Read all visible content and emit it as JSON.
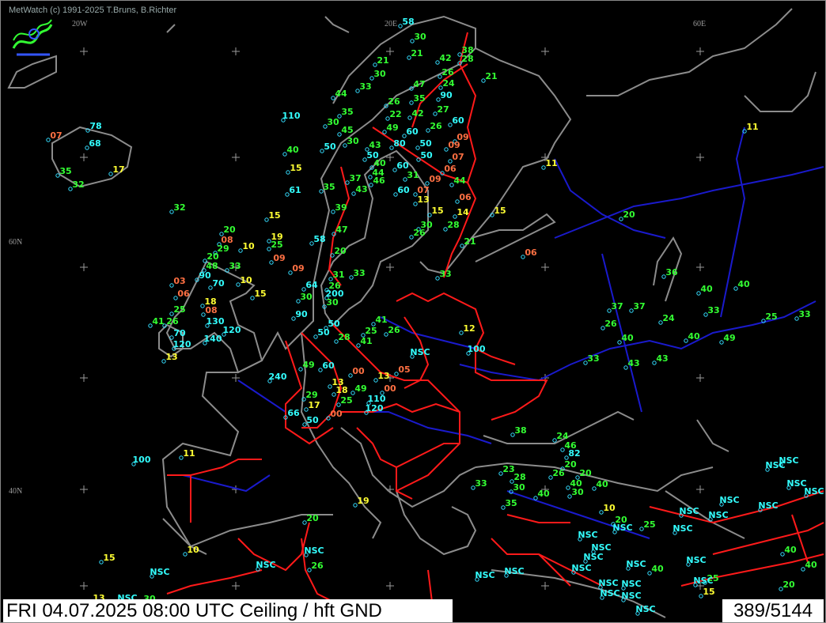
{
  "header": {
    "credit": "MetWatch  (c) 1991-2025 T.Bruns, B.Richter"
  },
  "footer": {
    "datetime_and_product": "FRI 04.07.2025 08:00 UTC     Ceiling / hft GND",
    "count": "389/5144"
  },
  "grid_labels": [
    {
      "text": "20W",
      "lon": -20,
      "lat": "top"
    },
    {
      "text": "20E",
      "lon": 20,
      "lat": "top"
    },
    {
      "text": "60E",
      "lon": 60,
      "lat": "top"
    },
    {
      "text": "60N",
      "lon": "left",
      "lat": 60
    },
    {
      "text": "40N",
      "lon": "left",
      "lat": 40
    }
  ],
  "colors": {
    "red": "#ff7043",
    "yellow": "#ffff33",
    "green": "#33ff33",
    "cyan": "#33ffff",
    "coast": "#8c8c8c",
    "river": "#1a1acc",
    "border": "#ff1a1a"
  },
  "stations": [
    {
      "t": "58",
      "c": "cyan"
    },
    {
      "t": "30",
      "c": "green"
    },
    {
      "t": "38",
      "c": "green"
    },
    {
      "t": "28",
      "c": "green"
    },
    {
      "t": "21",
      "c": "green"
    },
    {
      "t": "30",
      "c": "green"
    },
    {
      "t": "21",
      "c": "green"
    },
    {
      "t": "42",
      "c": "green"
    },
    {
      "t": "26",
      "c": "green"
    },
    {
      "t": "21",
      "c": "green"
    },
    {
      "t": "33",
      "c": "green"
    },
    {
      "t": "47",
      "c": "green"
    },
    {
      "t": "24",
      "c": "green"
    },
    {
      "t": "44",
      "c": "green"
    },
    {
      "t": "35",
      "c": "green"
    },
    {
      "t": "90",
      "c": "cyan"
    },
    {
      "t": "26",
      "c": "green"
    },
    {
      "t": "35",
      "c": "green"
    },
    {
      "t": "22",
      "c": "green"
    },
    {
      "t": "42",
      "c": "green"
    },
    {
      "t": "27",
      "c": "green"
    },
    {
      "t": "110",
      "c": "cyan"
    },
    {
      "t": "30",
      "c": "green"
    },
    {
      "t": "60",
      "c": "cyan"
    },
    {
      "t": "78",
      "c": "cyan"
    },
    {
      "t": "45",
      "c": "green"
    },
    {
      "t": "49",
      "c": "green"
    },
    {
      "t": "60",
      "c": "cyan"
    },
    {
      "t": "26",
      "c": "green"
    },
    {
      "t": "07",
      "c": "red"
    },
    {
      "t": "68",
      "c": "cyan"
    },
    {
      "t": "30",
      "c": "green"
    },
    {
      "t": "43",
      "c": "green"
    },
    {
      "t": "80",
      "c": "cyan"
    },
    {
      "t": "50",
      "c": "cyan"
    },
    {
      "t": "09",
      "c": "red"
    },
    {
      "t": "09",
      "c": "red"
    },
    {
      "t": "11",
      "c": "yellow"
    },
    {
      "t": "40",
      "c": "green"
    },
    {
      "t": "50",
      "c": "cyan"
    },
    {
      "t": "50",
      "c": "cyan"
    },
    {
      "t": "50",
      "c": "cyan"
    },
    {
      "t": "07",
      "c": "red"
    },
    {
      "t": "40",
      "c": "green"
    },
    {
      "t": "60",
      "c": "cyan"
    },
    {
      "t": "06",
      "c": "red"
    },
    {
      "t": "11",
      "c": "yellow"
    },
    {
      "t": "15",
      "c": "yellow"
    },
    {
      "t": "17",
      "c": "yellow"
    },
    {
      "t": "35",
      "c": "green"
    },
    {
      "t": "44",
      "c": "green"
    },
    {
      "t": "31",
      "c": "green"
    },
    {
      "t": "09",
      "c": "red"
    },
    {
      "t": "44",
      "c": "green"
    },
    {
      "t": "32",
      "c": "green"
    },
    {
      "t": "37",
      "c": "green"
    },
    {
      "t": "46",
      "c": "green"
    },
    {
      "t": "60",
      "c": "cyan"
    },
    {
      "t": "07",
      "c": "red"
    },
    {
      "t": "35",
      "c": "green"
    },
    {
      "t": "43",
      "c": "green"
    },
    {
      "t": "61",
      "c": "cyan"
    },
    {
      "t": "13",
      "c": "yellow"
    },
    {
      "t": "06",
      "c": "red"
    },
    {
      "t": "32",
      "c": "green"
    },
    {
      "t": "39",
      "c": "green"
    },
    {
      "t": "15",
      "c": "yellow"
    },
    {
      "t": "14",
      "c": "yellow"
    },
    {
      "t": "15",
      "c": "yellow"
    },
    {
      "t": "20",
      "c": "green"
    },
    {
      "t": "15",
      "c": "yellow"
    },
    {
      "t": "30",
      "c": "green"
    },
    {
      "t": "28",
      "c": "green"
    },
    {
      "t": "20",
      "c": "green"
    },
    {
      "t": "47",
      "c": "green"
    },
    {
      "t": "19",
      "c": "yellow"
    },
    {
      "t": "08",
      "c": "red"
    },
    {
      "t": "58",
      "c": "cyan"
    },
    {
      "t": "26",
      "c": "green"
    },
    {
      "t": "21",
      "c": "green"
    },
    {
      "t": "25",
      "c": "green"
    },
    {
      "t": "10",
      "c": "yellow"
    },
    {
      "t": "29",
      "c": "green"
    },
    {
      "t": "20",
      "c": "green"
    },
    {
      "t": "09",
      "c": "red"
    },
    {
      "t": "06",
      "c": "red"
    },
    {
      "t": "20",
      "c": "green"
    },
    {
      "t": "33",
      "c": "green"
    },
    {
      "t": "09",
      "c": "red"
    },
    {
      "t": "48",
      "c": "green"
    },
    {
      "t": "33",
      "c": "green"
    },
    {
      "t": "31",
      "c": "green"
    },
    {
      "t": "33",
      "c": "green"
    },
    {
      "t": "90",
      "c": "cyan"
    },
    {
      "t": "10",
      "c": "yellow"
    },
    {
      "t": "36",
      "c": "green"
    },
    {
      "t": "03",
      "c": "red"
    },
    {
      "t": "64",
      "c": "cyan"
    },
    {
      "t": "26",
      "c": "green"
    },
    {
      "t": "40",
      "c": "green"
    },
    {
      "t": "40",
      "c": "green"
    },
    {
      "t": "70",
      "c": "cyan"
    },
    {
      "t": "15",
      "c": "yellow"
    },
    {
      "t": "06",
      "c": "red"
    },
    {
      "t": "30",
      "c": "green"
    },
    {
      "t": "200",
      "c": "cyan"
    },
    {
      "t": "18",
      "c": "yellow"
    },
    {
      "t": "30",
      "c": "green"
    },
    {
      "t": "37",
      "c": "green"
    },
    {
      "t": "37",
      "c": "green"
    },
    {
      "t": "33",
      "c": "green"
    },
    {
      "t": "25",
      "c": "green"
    },
    {
      "t": "08",
      "c": "red"
    },
    {
      "t": "90",
      "c": "cyan"
    },
    {
      "t": "50",
      "c": "cyan"
    },
    {
      "t": "24",
      "c": "green"
    },
    {
      "t": "25",
      "c": "green"
    },
    {
      "t": "33",
      "c": "green"
    },
    {
      "t": "26",
      "c": "green"
    },
    {
      "t": "130",
      "c": "cyan"
    },
    {
      "t": "41",
      "c": "green"
    },
    {
      "t": "50",
      "c": "cyan"
    },
    {
      "t": "26",
      "c": "green"
    },
    {
      "t": "41",
      "c": "green"
    },
    {
      "t": "26",
      "c": "green"
    },
    {
      "t": "120",
      "c": "cyan"
    },
    {
      "t": "28",
      "c": "green"
    },
    {
      "t": "25",
      "c": "green"
    },
    {
      "t": "40",
      "c": "green"
    },
    {
      "t": "49",
      "c": "green"
    },
    {
      "t": "70",
      "c": "cyan"
    },
    {
      "t": "140",
      "c": "cyan"
    },
    {
      "t": "41",
      "c": "green"
    },
    {
      "t": "120",
      "c": "cyan"
    },
    {
      "t": "NSC",
      "c": "cyan"
    },
    {
      "t": "100",
      "c": "cyan"
    },
    {
      "t": "13",
      "c": "yellow"
    },
    {
      "t": "40",
      "c": "green"
    },
    {
      "t": "33",
      "c": "green"
    },
    {
      "t": "12",
      "c": "yellow"
    },
    {
      "t": "49",
      "c": "green"
    },
    {
      "t": "60",
      "c": "cyan"
    },
    {
      "t": "00",
      "c": "red"
    },
    {
      "t": "05",
      "c": "red"
    },
    {
      "t": "43",
      "c": "green"
    },
    {
      "t": "43",
      "c": "green"
    },
    {
      "t": "240",
      "c": "cyan"
    },
    {
      "t": "13",
      "c": "yellow"
    },
    {
      "t": "13",
      "c": "yellow"
    },
    {
      "t": "18",
      "c": "yellow"
    },
    {
      "t": "49",
      "c": "green"
    },
    {
      "t": "00",
      "c": "red"
    },
    {
      "t": "29",
      "c": "green"
    },
    {
      "t": "25",
      "c": "green"
    },
    {
      "t": "110",
      "c": "cyan"
    },
    {
      "t": "17",
      "c": "yellow"
    },
    {
      "t": "120",
      "c": "cyan"
    },
    {
      "t": "66",
      "c": "cyan"
    },
    {
      "t": "00",
      "c": "red"
    },
    {
      "t": "50",
      "c": "cyan"
    },
    {
      "t": "38",
      "c": "green"
    },
    {
      "t": "24",
      "c": "green"
    },
    {
      "t": "46",
      "c": "green"
    },
    {
      "t": "82",
      "c": "cyan"
    },
    {
      "t": "11",
      "c": "yellow"
    },
    {
      "t": "100",
      "c": "cyan"
    },
    {
      "t": "20",
      "c": "green"
    },
    {
      "t": "NSC",
      "c": "cyan"
    },
    {
      "t": "23",
      "c": "green"
    },
    {
      "t": "26",
      "c": "green"
    },
    {
      "t": "20",
      "c": "green"
    },
    {
      "t": "28",
      "c": "green"
    },
    {
      "t": "40",
      "c": "green"
    },
    {
      "t": "33",
      "c": "green"
    },
    {
      "t": "40",
      "c": "green"
    },
    {
      "t": "NSC",
      "c": "cyan"
    },
    {
      "t": "30",
      "c": "green"
    },
    {
      "t": "30",
      "c": "green"
    },
    {
      "t": "40",
      "c": "green"
    },
    {
      "t": "NSC",
      "c": "cyan"
    },
    {
      "t": "NSC",
      "c": "cyan"
    },
    {
      "t": "35",
      "c": "green"
    },
    {
      "t": "19",
      "c": "yellow"
    },
    {
      "t": "10",
      "c": "yellow"
    },
    {
      "t": "NSC",
      "c": "cyan"
    },
    {
      "t": "NSC",
      "c": "cyan"
    },
    {
      "t": "NSC",
      "c": "cyan"
    },
    {
      "t": "20",
      "c": "green"
    },
    {
      "t": "20",
      "c": "green"
    },
    {
      "t": "NSC",
      "c": "cyan"
    },
    {
      "t": "25",
      "c": "green"
    },
    {
      "t": "NSC",
      "c": "cyan"
    },
    {
      "t": "NSC",
      "c": "cyan"
    },
    {
      "t": "10",
      "c": "yellow"
    },
    {
      "t": "NSC",
      "c": "cyan"
    },
    {
      "t": "NSC",
      "c": "cyan"
    },
    {
      "t": "40",
      "c": "green"
    },
    {
      "t": "15",
      "c": "yellow"
    },
    {
      "t": "NSC",
      "c": "cyan"
    },
    {
      "t": "26",
      "c": "green"
    },
    {
      "t": "NSC",
      "c": "cyan"
    },
    {
      "t": "NSC",
      "c": "cyan"
    },
    {
      "t": "NSC",
      "c": "cyan"
    },
    {
      "t": "NSC",
      "c": "cyan"
    },
    {
      "t": "NSC",
      "c": "cyan"
    },
    {
      "t": "40",
      "c": "green"
    },
    {
      "t": "25",
      "c": "green"
    },
    {
      "t": "NSC",
      "c": "cyan"
    },
    {
      "t": "NSC",
      "c": "cyan"
    },
    {
      "t": "NSC",
      "c": "cyan"
    },
    {
      "t": "NSC",
      "c": "cyan"
    },
    {
      "t": "NSC",
      "c": "cyan"
    },
    {
      "t": "NSC",
      "c": "cyan"
    },
    {
      "t": "40",
      "c": "green"
    },
    {
      "t": "NSC",
      "c": "cyan"
    },
    {
      "t": "NSC",
      "c": "cyan"
    },
    {
      "t": "20",
      "c": "green"
    },
    {
      "t": "15",
      "c": "yellow"
    },
    {
      "t": "13",
      "c": "yellow"
    },
    {
      "t": "NSC",
      "c": "cyan"
    },
    {
      "t": "30",
      "c": "green"
    },
    {
      "t": "NSC",
      "c": "cyan"
    }
  ]
}
